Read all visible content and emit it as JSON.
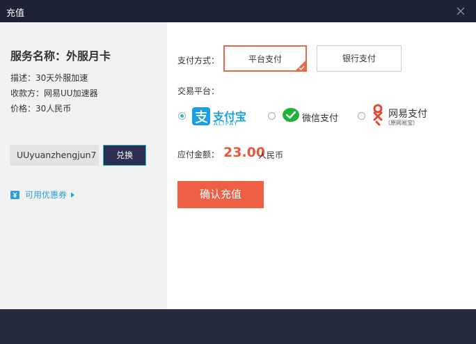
{
  "window": {
    "title": "充值"
  },
  "service": {
    "name": "服务名称：外服月卡",
    "description": "描述：30天外服加速",
    "payee": "收款方：网易UU加速器",
    "price": "价格：30人民币"
  },
  "code": {
    "value": "UUyuanzhengjun7",
    "exchange_label": "兑换"
  },
  "coupon": {
    "label": "可用优惠券"
  },
  "payment": {
    "method_label": "支付方式：",
    "methods": [
      "平台支付",
      "银行支付"
    ],
    "platform_label": "交易平台：",
    "platforms": {
      "alipay": {
        "text": "支付宝",
        "sub": "ALIPAY"
      },
      "wechat": {
        "text": "微信支付"
      },
      "netease": {
        "text": "网易支付",
        "sub": "（原网易宝）"
      }
    },
    "selected_platform": "alipay"
  },
  "amount": {
    "label": "应付金额：",
    "value": "23.00",
    "unit": "人民币"
  },
  "confirm": {
    "label": "确认充值"
  },
  "colors": {
    "accent": "#ef5f45",
    "titlebar": "#1e2237",
    "teal": "#2bb8c9",
    "link": "#2a9fd6",
    "alipay": "#1a9fe0",
    "wechat": "#20b33a",
    "netease": "#e8432f"
  }
}
